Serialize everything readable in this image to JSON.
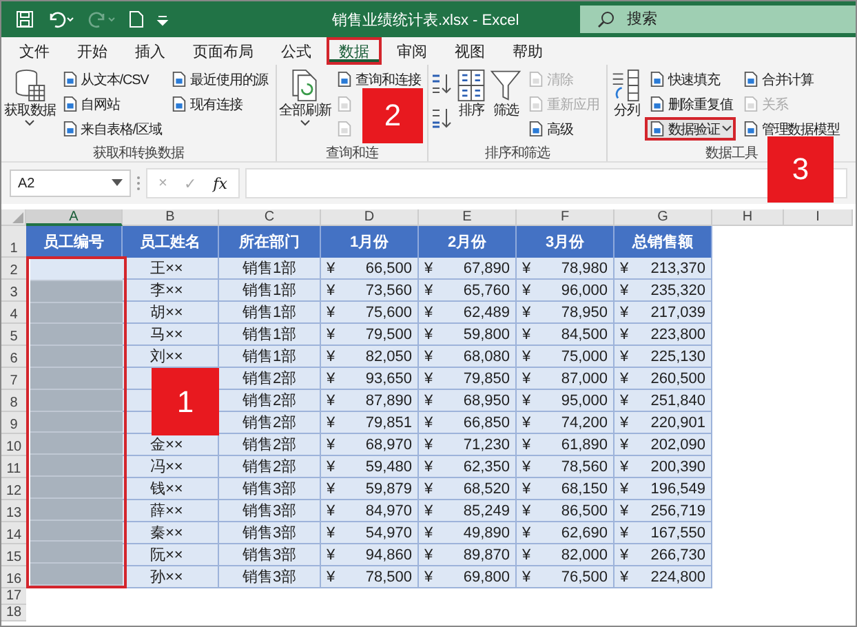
{
  "title_bar": {
    "file_title": "销售业绩统计表.xlsx  -  Excel",
    "search_placeholder": "搜索"
  },
  "menu_tabs": [
    {
      "label": "文件",
      "selected": false,
      "highlighted": false
    },
    {
      "label": "开始",
      "selected": false,
      "highlighted": false
    },
    {
      "label": "插入",
      "selected": false,
      "highlighted": false
    },
    {
      "label": "页面布局",
      "selected": false,
      "highlighted": false
    },
    {
      "label": "公式",
      "selected": false,
      "highlighted": false
    },
    {
      "label": "数据",
      "selected": true,
      "highlighted": true
    },
    {
      "label": "审阅",
      "selected": false,
      "highlighted": false
    },
    {
      "label": "视图",
      "selected": false,
      "highlighted": false
    },
    {
      "label": "帮助",
      "selected": false,
      "highlighted": false
    }
  ],
  "ribbon_groups": [
    {
      "label": "获取和转换数据",
      "items": [
        {
          "kind": "large",
          "label": "获取数据",
          "dropdown": true,
          "disabled": false
        },
        {
          "kind": "small",
          "label": "从文本/CSV",
          "disabled": false
        },
        {
          "kind": "small",
          "label": "自网站",
          "disabled": false
        },
        {
          "kind": "small",
          "label": "来自表格/区域",
          "disabled": false
        },
        {
          "kind": "small",
          "label": "最近使用的源",
          "disabled": false
        },
        {
          "kind": "small",
          "label": "现有连接",
          "disabled": false
        }
      ]
    },
    {
      "label": "查询和连",
      "items": [
        {
          "kind": "large",
          "label": "全部刷新",
          "dropdown": true,
          "disabled": false
        },
        {
          "kind": "small",
          "label": "查询和连接",
          "disabled": false
        },
        {
          "kind": "small_icon",
          "disabled": true
        },
        {
          "kind": "small_icon",
          "disabled": true
        }
      ]
    },
    {
      "label": "排序和筛选",
      "items": [
        {
          "kind": "sort_asc"
        },
        {
          "kind": "sort_desc"
        },
        {
          "kind": "large",
          "label": "排序",
          "dropdown": false,
          "disabled": false
        },
        {
          "kind": "large",
          "label": "筛选",
          "dropdown": false,
          "disabled": false
        },
        {
          "kind": "small",
          "label": "清除",
          "disabled": true
        },
        {
          "kind": "small",
          "label": "重新应用",
          "disabled": true
        },
        {
          "kind": "small",
          "label": "高级",
          "disabled": false
        }
      ]
    },
    {
      "label": "数据工具",
      "items": [
        {
          "kind": "large",
          "label": "分列",
          "dropdown": false,
          "disabled": false
        },
        {
          "kind": "small",
          "label": "快速填充",
          "disabled": false
        },
        {
          "kind": "small",
          "label": "删除重复值",
          "disabled": false
        },
        {
          "kind": "small",
          "label": "数据验证",
          "dropdown": true,
          "highlighted": true,
          "disabled": false
        },
        {
          "kind": "small",
          "label": "合并计算",
          "disabled": false
        },
        {
          "kind": "small",
          "label": "关系",
          "disabled": true
        },
        {
          "kind": "small",
          "label": "管理数据模型",
          "disabled": false
        }
      ]
    }
  ],
  "formula_bar": {
    "name_box": "A2",
    "cancel": "×",
    "enter": "✓",
    "function": "fx"
  },
  "sheet": {
    "columns": [
      {
        "label": "A",
        "selected": true
      },
      {
        "label": "B",
        "selected": false
      },
      {
        "label": "C",
        "selected": false
      },
      {
        "label": "D",
        "selected": false
      },
      {
        "label": "E",
        "selected": false
      },
      {
        "label": "F",
        "selected": false
      },
      {
        "label": "G",
        "selected": false
      },
      {
        "label": "H",
        "selected": false
      },
      {
        "label": "I",
        "selected": false
      }
    ],
    "header_row": {
      "number": "1",
      "cells": [
        "员工编号",
        "员工姓名",
        "所在部门",
        "1月份",
        "2月份",
        "3月份",
        "总销售额"
      ]
    },
    "rows": [
      {
        "number": "2",
        "a_active": true,
        "a_selected": true,
        "name": "王××",
        "dept": "销售1部",
        "amounts": [
          {
            "symbol": "¥",
            "value": "66,500"
          },
          {
            "symbol": "¥",
            "value": "67,890"
          },
          {
            "symbol": "¥",
            "value": "78,980"
          },
          {
            "symbol": "¥",
            "value": "213,370"
          }
        ]
      },
      {
        "number": "3",
        "a_active": false,
        "a_selected": true,
        "name": "李××",
        "dept": "销售1部",
        "amounts": [
          {
            "symbol": "¥",
            "value": "73,560"
          },
          {
            "symbol": "¥",
            "value": "65,760"
          },
          {
            "symbol": "¥",
            "value": "96,000"
          },
          {
            "symbol": "¥",
            "value": "235,320"
          }
        ]
      },
      {
        "number": "4",
        "a_active": false,
        "a_selected": true,
        "name": "胡××",
        "dept": "销售1部",
        "amounts": [
          {
            "symbol": "¥",
            "value": "75,600"
          },
          {
            "symbol": "¥",
            "value": "62,489"
          },
          {
            "symbol": "¥",
            "value": "78,950"
          },
          {
            "symbol": "¥",
            "value": "217,039"
          }
        ]
      },
      {
        "number": "5",
        "a_active": false,
        "a_selected": true,
        "name": "马××",
        "dept": "销售1部",
        "amounts": [
          {
            "symbol": "¥",
            "value": "79,500"
          },
          {
            "symbol": "¥",
            "value": "59,800"
          },
          {
            "symbol": "¥",
            "value": "84,500"
          },
          {
            "symbol": "¥",
            "value": "223,800"
          }
        ]
      },
      {
        "number": "6",
        "a_active": false,
        "a_selected": true,
        "name": "刘××",
        "dept": "销售1部",
        "amounts": [
          {
            "symbol": "¥",
            "value": "82,050"
          },
          {
            "symbol": "¥",
            "value": "68,080"
          },
          {
            "symbol": "¥",
            "value": "75,000"
          },
          {
            "symbol": "¥",
            "value": "225,130"
          }
        ]
      },
      {
        "number": "7",
        "a_active": false,
        "a_selected": true,
        "dept": "销售2部",
        "amounts": [
          {
            "symbol": "¥",
            "value": "93,650"
          },
          {
            "symbol": "¥",
            "value": "79,850"
          },
          {
            "symbol": "¥",
            "value": "87,000"
          },
          {
            "symbol": "¥",
            "value": "260,500"
          }
        ]
      },
      {
        "number": "8",
        "a_active": false,
        "a_selected": true,
        "dept": "销售2部",
        "amounts": [
          {
            "symbol": "¥",
            "value": "87,890"
          },
          {
            "symbol": "¥",
            "value": "68,950"
          },
          {
            "symbol": "¥",
            "value": "95,000"
          },
          {
            "symbol": "¥",
            "value": "251,840"
          }
        ]
      },
      {
        "number": "9",
        "a_active": false,
        "a_selected": true,
        "dept": "销售2部",
        "amounts": [
          {
            "symbol": "¥",
            "value": "79,851"
          },
          {
            "symbol": "¥",
            "value": "66,850"
          },
          {
            "symbol": "¥",
            "value": "74,200"
          },
          {
            "symbol": "¥",
            "value": "220,901"
          }
        ]
      },
      {
        "number": "10",
        "a_active": false,
        "a_selected": true,
        "name": "金××",
        "dept": "销售2部",
        "amounts": [
          {
            "symbol": "¥",
            "value": "68,970"
          },
          {
            "symbol": "¥",
            "value": "71,230"
          },
          {
            "symbol": "¥",
            "value": "61,890"
          },
          {
            "symbol": "¥",
            "value": "202,090"
          }
        ]
      },
      {
        "number": "11",
        "a_active": false,
        "a_selected": true,
        "name": "冯××",
        "dept": "销售2部",
        "amounts": [
          {
            "symbol": "¥",
            "value": "59,480"
          },
          {
            "symbol": "¥",
            "value": "62,350"
          },
          {
            "symbol": "¥",
            "value": "78,560"
          },
          {
            "symbol": "¥",
            "value": "200,390"
          }
        ]
      },
      {
        "number": "12",
        "a_active": false,
        "a_selected": true,
        "name": "钱××",
        "dept": "销售3部",
        "amounts": [
          {
            "symbol": "¥",
            "value": "59,879"
          },
          {
            "symbol": "¥",
            "value": "68,520"
          },
          {
            "symbol": "¥",
            "value": "68,150"
          },
          {
            "symbol": "¥",
            "value": "196,549"
          }
        ]
      },
      {
        "number": "13",
        "a_active": false,
        "a_selected": true,
        "name": "薛××",
        "dept": "销售3部",
        "amounts": [
          {
            "symbol": "¥",
            "value": "84,970"
          },
          {
            "symbol": "¥",
            "value": "85,249"
          },
          {
            "symbol": "¥",
            "value": "86,500"
          },
          {
            "symbol": "¥",
            "value": "256,719"
          }
        ]
      },
      {
        "number": "14",
        "a_active": false,
        "a_selected": true,
        "name": "秦××",
        "dept": "销售3部",
        "amounts": [
          {
            "symbol": "¥",
            "value": "54,970"
          },
          {
            "symbol": "¥",
            "value": "49,890"
          },
          {
            "symbol": "¥",
            "value": "62,690"
          },
          {
            "symbol": "¥",
            "value": "167,550"
          }
        ]
      },
      {
        "number": "15",
        "a_active": false,
        "a_selected": true,
        "name": "阮××",
        "dept": "销售3部",
        "amounts": [
          {
            "symbol": "¥",
            "value": "94,860"
          },
          {
            "symbol": "¥",
            "value": "89,870"
          },
          {
            "symbol": "¥",
            "value": "82,000"
          },
          {
            "symbol": "¥",
            "value": "266,730"
          }
        ]
      },
      {
        "number": "16",
        "a_active": false,
        "a_selected": true,
        "name": "孙××",
        "dept": "销售3部",
        "amounts": [
          {
            "symbol": "¥",
            "value": "78,500"
          },
          {
            "symbol": "¥",
            "value": "69,800"
          },
          {
            "symbol": "¥",
            "value": "76,500"
          },
          {
            "symbol": "¥",
            "value": "224,800"
          }
        ]
      }
    ],
    "empty_rows": [
      {
        "number": "17"
      },
      {
        "number": "18"
      }
    ]
  },
  "callouts": [
    {
      "label": "1"
    },
    {
      "label": "2"
    },
    {
      "label": "3"
    }
  ]
}
